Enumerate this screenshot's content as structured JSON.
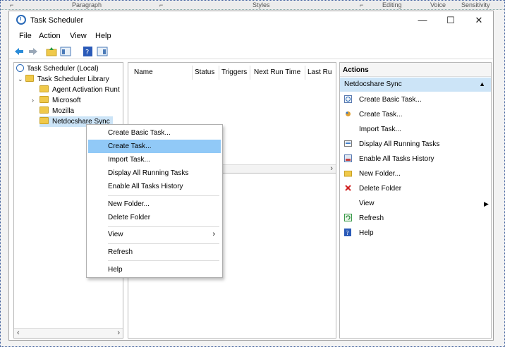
{
  "ribbon": {
    "labels": [
      "Paragraph",
      "Styles",
      "Editing",
      "Voice",
      "Sensitivity"
    ]
  },
  "window": {
    "title": "Task Scheduler",
    "controls": {
      "minimize": "—",
      "maximize": "☐",
      "close": "✕"
    }
  },
  "menu": [
    "File",
    "Action",
    "View",
    "Help"
  ],
  "tree": {
    "root": "Task Scheduler (Local)",
    "library": "Task Scheduler Library",
    "children": [
      "Agent Activation Runt",
      "Microsoft",
      "Mozilla",
      "Netdocshare Sync"
    ]
  },
  "columns": [
    "Name",
    "Status",
    "Triggers",
    "Next Run Time",
    "Last Ru"
  ],
  "actions": {
    "header": "Actions",
    "section": "Netdocshare Sync",
    "items": [
      {
        "label": "Create Basic Task...",
        "icon": "create-basic-task-icon"
      },
      {
        "label": "Create Task...",
        "icon": "create-task-icon"
      },
      {
        "label": "Import Task...",
        "icon": ""
      },
      {
        "label": "Display All Running Tasks",
        "icon": "running-tasks-icon"
      },
      {
        "label": "Enable All Tasks History",
        "icon": "history-icon"
      },
      {
        "label": "New Folder...",
        "icon": "folder-icon"
      },
      {
        "label": "Delete Folder",
        "icon": "delete-icon"
      },
      {
        "label": "View",
        "icon": ""
      },
      {
        "label": "Refresh",
        "icon": "refresh-icon"
      },
      {
        "label": "Help",
        "icon": "help-icon"
      }
    ]
  },
  "context_menu": {
    "items": [
      "Create Basic Task...",
      "Create Task...",
      "Import Task...",
      "Display All Running Tasks",
      "Enable All Tasks History",
      "New Folder...",
      "Delete Folder",
      "View",
      "Refresh",
      "Help"
    ],
    "highlighted": "Create Task..."
  },
  "colors": {
    "selection": "#cce4f7",
    "menu_hover": "#91c9f7",
    "accent": "#2a6ab8"
  }
}
